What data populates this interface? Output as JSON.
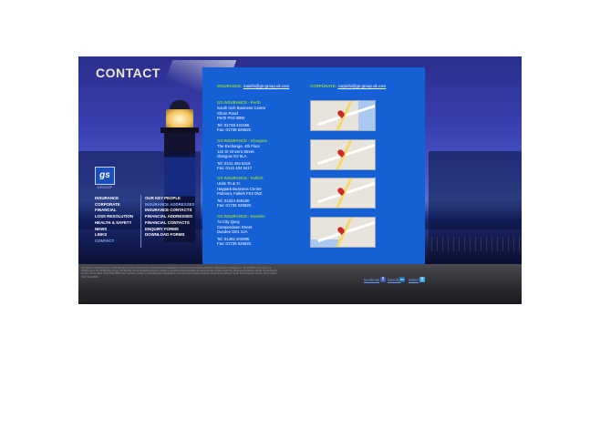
{
  "page": {
    "title": "CONTACT"
  },
  "brand": {
    "logo_text": "gs",
    "logo_sub": "GROUP"
  },
  "nav": {
    "col1": [
      "INSURANCE",
      "CORPORATE",
      "FINANCIAL",
      "LOSS RESOLUTION",
      "HEALTH & SAFETY",
      "NEWS",
      "LINKS",
      "CONTACT"
    ],
    "col2": [
      "OUR KEY PEOPLE",
      "INSURANCE ADDRESSES",
      "INSURANCE CONTACTS",
      "FINANCIAL ADDRESSES",
      "FINANCIAL CONTACTS",
      "ENQUIRY FORMS",
      "DOWNLOAD FORMS"
    ],
    "active_col1": "CONTACT",
    "active_col2": "INSURANCE ADDRESSES"
  },
  "contact": {
    "insurance_label": "INSURANCE:",
    "insurance_email": "mainfo@gs-group.uk.com",
    "corporate_label": "CORPORATE:",
    "corporate_email": "corpinfo@gs-group.uk.com"
  },
  "offices": [
    {
      "heading": "GS INSURANCE - Perth",
      "lines": [
        "South Inch Business Centre",
        "Shore Road",
        "Perth PH2 8BW"
      ],
      "tel": "Tel: 01738 441555",
      "fax": "Fax: 01738 625820"
    },
    {
      "heading": "GS INSURANCE - Glasgow",
      "lines": [
        "The Exchange, 4th Floor",
        "142 St Vincent Street",
        "Glasgow G2 5LA"
      ],
      "tel": "Tel: 0141 404 5416",
      "fax": "Fax: 0141 404 5417"
    },
    {
      "heading": "GS INSURANCE - Falkirk",
      "lines": [
        "Units 7b & 7c",
        "Haypark Business Centre",
        "Polmont, Falkirk FK2 0NZ"
      ],
      "tel": "Tel: 01324 468180",
      "fax": "Fax: 01738 625820"
    },
    {
      "heading": "GS INSURANCE - Dundee",
      "lines": [
        "7a City Quay",
        "Camperdown Street",
        "Dundee DD1 3JA"
      ],
      "tel": "Tel: 01382 202905",
      "fax": "Fax: 01738 625820"
    }
  ],
  "footer": {
    "legal": "GS group is a trading name of GS Barclay Group Limited which is authorised and regulated by the Financial Conduct Authority. Registered in Scotland no. SC 000000. GS Group is a trading name for GS Barclay Group. GS Barclay Group Financial Services Limited is authorised and regulated by the Financial Conduct Authority. Registered address: South Inch Business Centre, Shore Road, Perth PH2 8BW. GS Insurance Limited is authorised and regulated by the Financial Conduct Authority. Registered address: South Inch Business Centre, Shore Road, Perth PH2 8BW.",
    "facebook": "facebook",
    "linkedin": "linkedin",
    "twitter": "twitter"
  }
}
